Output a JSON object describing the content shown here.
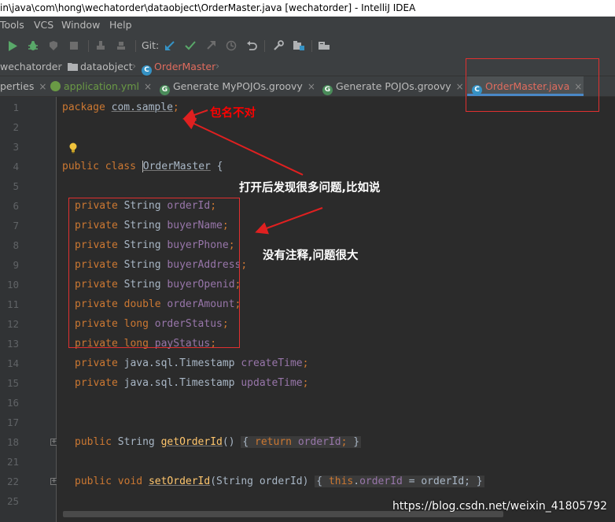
{
  "window": {
    "title": "in\\java\\com\\hong\\wechatorder\\dataobject\\OrderMaster.java [wechatorder] - IntelliJ IDEA"
  },
  "menu": {
    "items": [
      "Tools",
      "VCS",
      "Window",
      "Help"
    ]
  },
  "toolbar": {
    "git_label": "Git:"
  },
  "breadcrumb": {
    "items": [
      "wechatorder",
      "dataobject",
      "OrderMaster"
    ]
  },
  "tabs": [
    {
      "label": "perties",
      "icon": "properties-file-icon",
      "active": false
    },
    {
      "label": "application.yml",
      "icon": "yaml-leaf-icon",
      "active": false
    },
    {
      "label": "Generate MyPOJOs.groovy",
      "icon": "groovy-icon",
      "active": false
    },
    {
      "label": "Generate POJOs.groovy",
      "icon": "groovy-icon",
      "active": false
    },
    {
      "label": "OrderMaster.java",
      "icon": "java-class-icon",
      "active": true
    }
  ],
  "editor": {
    "line_numbers": [
      "1",
      "2",
      "3",
      "4",
      "5",
      "6",
      "7",
      "8",
      "9",
      "10",
      "11",
      "12",
      "13",
      "14",
      "15",
      "16",
      "17",
      "18",
      "21",
      "22",
      "25"
    ],
    "code": {
      "l1_kw": "package",
      "l1_pkg": "com.sample",
      "l1_end": ";",
      "l4_kw": "public class",
      "l4_cls": "OrderMaster",
      "l4_end": " {",
      "fields": [
        {
          "mod": "private",
          "type": "String",
          "name": "orderId"
        },
        {
          "mod": "private",
          "type": "String",
          "name": "buyerName"
        },
        {
          "mod": "private",
          "type": "String",
          "name": "buyerPhone"
        },
        {
          "mod": "private",
          "type": "String",
          "name": "buyerAddress"
        },
        {
          "mod": "private",
          "type": "String",
          "name": "buyerOpenid"
        },
        {
          "mod": "private",
          "type": "double",
          "name": "orderAmount"
        },
        {
          "mod": "private",
          "type": "long",
          "name": "orderStatus"
        },
        {
          "mod": "private",
          "type": "long",
          "name": "payStatus"
        },
        {
          "mod": "private",
          "type": "java.sql.Timestamp",
          "name": "createTime"
        },
        {
          "mod": "private",
          "type": "java.sql.Timestamp",
          "name": "updateTime"
        }
      ],
      "getter": {
        "mod": "public",
        "type": "String",
        "name": "getOrderId",
        "body_kw": "return",
        "body_field": "orderId"
      },
      "setter": {
        "mod": "public",
        "type": "void",
        "name": "setOrderId",
        "param": "String orderId",
        "this_kw": "this",
        "field": "orderId",
        "assign": " = orderId;"
      }
    }
  },
  "annotations": {
    "package_wrong": "包名不对",
    "many_problems": "打开后发现很多问题,比如说",
    "no_comments": "没有注释,问题很大"
  },
  "watermark": "https://blog.csdn.net/weixin_41805792",
  "colors": {
    "annotation_red": "#ff0000",
    "keyword": "#cc7832",
    "field": "#9876aa",
    "method": "#ffc66d",
    "editor_bg": "#2b2b2b"
  }
}
